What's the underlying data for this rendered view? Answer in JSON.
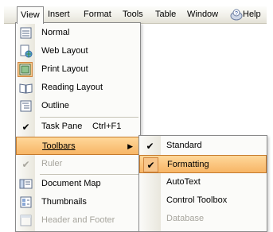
{
  "menubar": {
    "items": [
      "View",
      "Insert",
      "Format",
      "Tools",
      "Table",
      "Window",
      "Help"
    ],
    "active": "View"
  },
  "view_menu": {
    "items": [
      {
        "label": "Normal",
        "icon": "normal-view-icon"
      },
      {
        "label": "Web Layout",
        "icon": "web-layout-icon"
      },
      {
        "label": "Print Layout",
        "icon": "print-layout-icon",
        "state": "selected"
      },
      {
        "label": "Reading Layout",
        "icon": "reading-layout-icon"
      },
      {
        "label": "Outline",
        "icon": "outline-icon"
      },
      {
        "label": "Task Pane",
        "shortcut": "Ctrl+F1",
        "checked": true
      },
      {
        "label": "Toolbars",
        "submenu": true,
        "highlighted": true
      },
      {
        "label": "Ruler",
        "checked": true,
        "disabled": true
      },
      {
        "label": "Document Map",
        "icon": "document-map-icon"
      },
      {
        "label": "Thumbnails",
        "icon": "thumbnails-icon"
      },
      {
        "label": "Header and Footer",
        "icon": "header-footer-icon",
        "partial": true
      }
    ]
  },
  "toolbars_submenu": {
    "items": [
      {
        "label": "Standard",
        "checked": true
      },
      {
        "label": "Formatting",
        "checked": true,
        "highlighted": true
      },
      {
        "label": "AutoText"
      },
      {
        "label": "Control Toolbox"
      },
      {
        "label": "Database",
        "partial": true
      }
    ]
  },
  "colors": {
    "highlight_top": "#ffd89a",
    "highlight_bottom": "#f7b566",
    "highlight_border": "#c57a2c",
    "menu_bg": "#fbfbf9"
  }
}
